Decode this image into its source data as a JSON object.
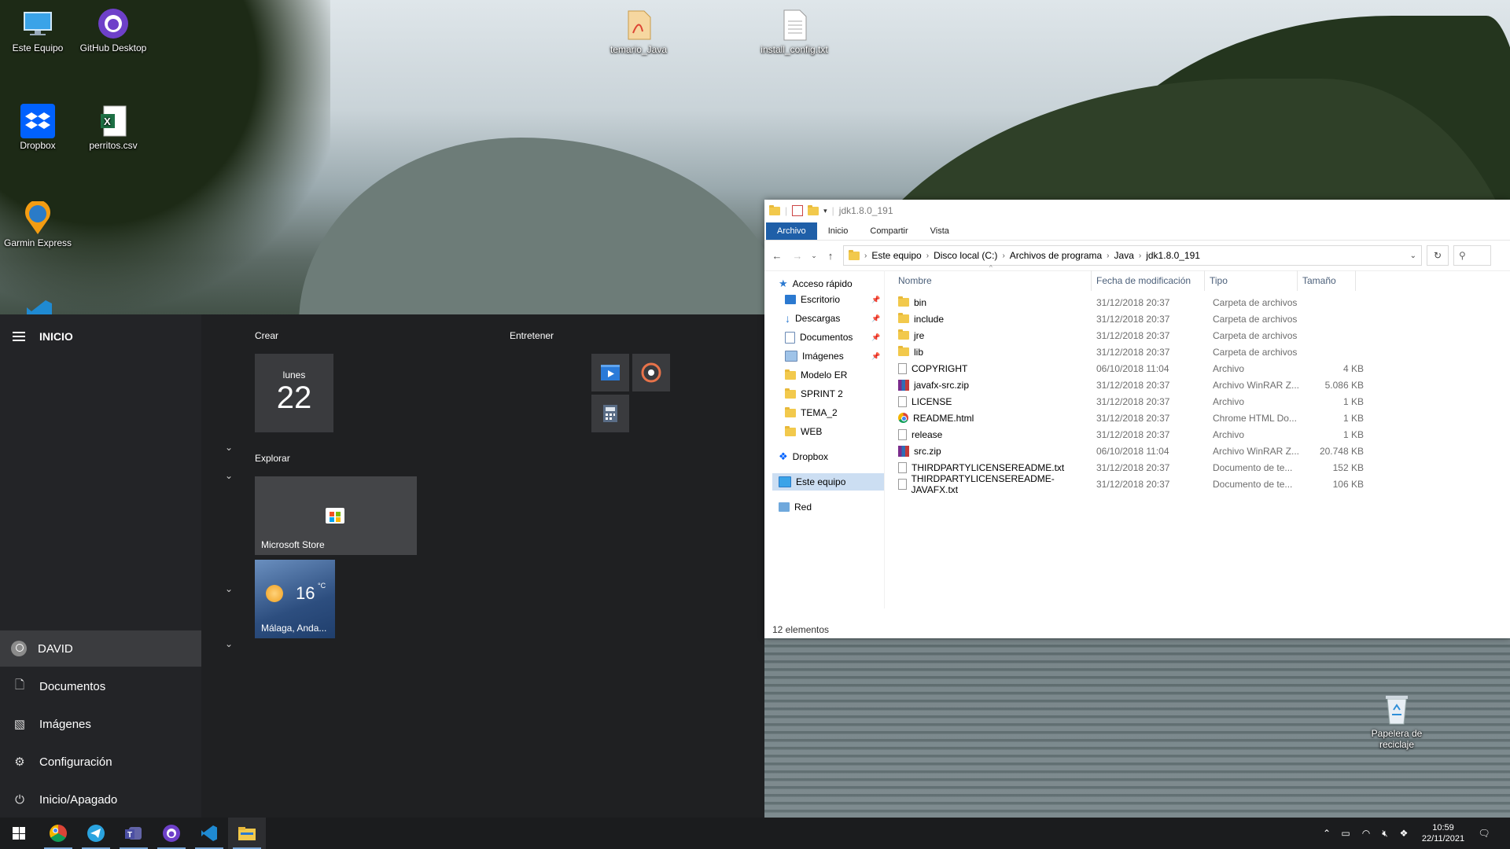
{
  "desktop": {
    "icons": [
      {
        "label": "Este Equipo",
        "icon": "monitor-icon"
      },
      {
        "label": "GitHub Desktop",
        "icon": "github-icon"
      },
      {
        "label": "Dropbox",
        "icon": "dropbox-icon"
      },
      {
        "label": "perritos.csv",
        "icon": "excel-icon"
      },
      {
        "label": "Garmin Express",
        "icon": "garmin-icon"
      },
      {
        "label": "temario_Java",
        "icon": "pdf-icon"
      },
      {
        "label": "install_config.txt",
        "icon": "text-file-icon"
      },
      {
        "label": "Papelera de reciclaje",
        "icon": "recycle-bin-icon"
      }
    ]
  },
  "start_menu": {
    "title": "INICIO",
    "side_items": [
      {
        "label": "DAVID",
        "icon": "user-icon"
      },
      {
        "label": "Documentos",
        "icon": "document-icon"
      },
      {
        "label": "Imágenes",
        "icon": "pictures-icon"
      },
      {
        "label": "Configuración",
        "icon": "gear-icon"
      },
      {
        "label": "Inicio/Apagado",
        "icon": "power-icon"
      }
    ],
    "groups": {
      "crear": "Crear",
      "entretener": "Entretener",
      "explorar": "Explorar"
    },
    "calendar": {
      "day_name": "lunes",
      "day_number": "22"
    },
    "store_label": "Microsoft Store",
    "weather": {
      "temperature": "16",
      "unit": "°C",
      "location": "Málaga, Anda..."
    }
  },
  "explorer": {
    "title": "jdk1.8.0_191",
    "ribbon_tabs": [
      "Archivo",
      "Inicio",
      "Compartir",
      "Vista"
    ],
    "breadcrumb": [
      "Este equipo",
      "Disco local (C:)",
      "Archivos de programa",
      "Java",
      "jdk1.8.0_191"
    ],
    "nav_pane": [
      {
        "label": "Acceso rápido",
        "icon": "star-icon"
      },
      {
        "label": "Escritorio",
        "icon": "desktop-icon",
        "pinned": true
      },
      {
        "label": "Descargas",
        "icon": "download-icon",
        "pinned": true
      },
      {
        "label": "Documentos",
        "icon": "document-icon",
        "pinned": true
      },
      {
        "label": "Imágenes",
        "icon": "pictures-icon",
        "pinned": true
      },
      {
        "label": "Modelo ER",
        "icon": "folder-icon"
      },
      {
        "label": "SPRINT 2",
        "icon": "folder-sync-icon"
      },
      {
        "label": "TEMA_2",
        "icon": "folder-sync-icon"
      },
      {
        "label": "WEB",
        "icon": "folder-sync-icon"
      },
      {
        "label": "Dropbox",
        "icon": "dropbox-icon"
      },
      {
        "label": "Este equipo",
        "icon": "monitor-icon",
        "selected": true
      },
      {
        "label": "Red",
        "icon": "network-icon"
      }
    ],
    "columns": [
      "Nombre",
      "Fecha de modificación",
      "Tipo",
      "Tamaño"
    ],
    "files": [
      {
        "name": "bin",
        "date": "31/12/2018 20:37",
        "type": "Carpeta de archivos",
        "size": "",
        "icon": "folder"
      },
      {
        "name": "include",
        "date": "31/12/2018 20:37",
        "type": "Carpeta de archivos",
        "size": "",
        "icon": "folder"
      },
      {
        "name": "jre",
        "date": "31/12/2018 20:37",
        "type": "Carpeta de archivos",
        "size": "",
        "icon": "folder"
      },
      {
        "name": "lib",
        "date": "31/12/2018 20:37",
        "type": "Carpeta de archivos",
        "size": "",
        "icon": "folder"
      },
      {
        "name": "COPYRIGHT",
        "date": "06/10/2018 11:04",
        "type": "Archivo",
        "size": "4 KB",
        "icon": "file"
      },
      {
        "name": "javafx-src.zip",
        "date": "31/12/2018 20:37",
        "type": "Archivo WinRAR Z...",
        "size": "5.086 KB",
        "icon": "rar"
      },
      {
        "name": "LICENSE",
        "date": "31/12/2018 20:37",
        "type": "Archivo",
        "size": "1 KB",
        "icon": "file"
      },
      {
        "name": "README.html",
        "date": "31/12/2018 20:37",
        "type": "Chrome HTML Do...",
        "size": "1 KB",
        "icon": "chrome"
      },
      {
        "name": "release",
        "date": "31/12/2018 20:37",
        "type": "Archivo",
        "size": "1 KB",
        "icon": "file"
      },
      {
        "name": "src.zip",
        "date": "06/10/2018 11:04",
        "type": "Archivo WinRAR Z...",
        "size": "20.748 KB",
        "icon": "rar"
      },
      {
        "name": "THIRDPARTYLICENSEREADME.txt",
        "date": "31/12/2018 20:37",
        "type": "Documento de te...",
        "size": "152 KB",
        "icon": "file"
      },
      {
        "name": "THIRDPARTYLICENSEREADME-JAVAFX.txt",
        "date": "31/12/2018 20:37",
        "type": "Documento de te...",
        "size": "106 KB",
        "icon": "file"
      }
    ],
    "status": "12 elementos"
  },
  "taskbar": {
    "apps": [
      "start-icon",
      "chrome-icon",
      "telegram-icon",
      "teams-icon",
      "github-desktop-icon",
      "vscode-icon",
      "file-explorer-icon"
    ],
    "clock": {
      "time": "10:59",
      "date": "22/11/2021"
    }
  }
}
